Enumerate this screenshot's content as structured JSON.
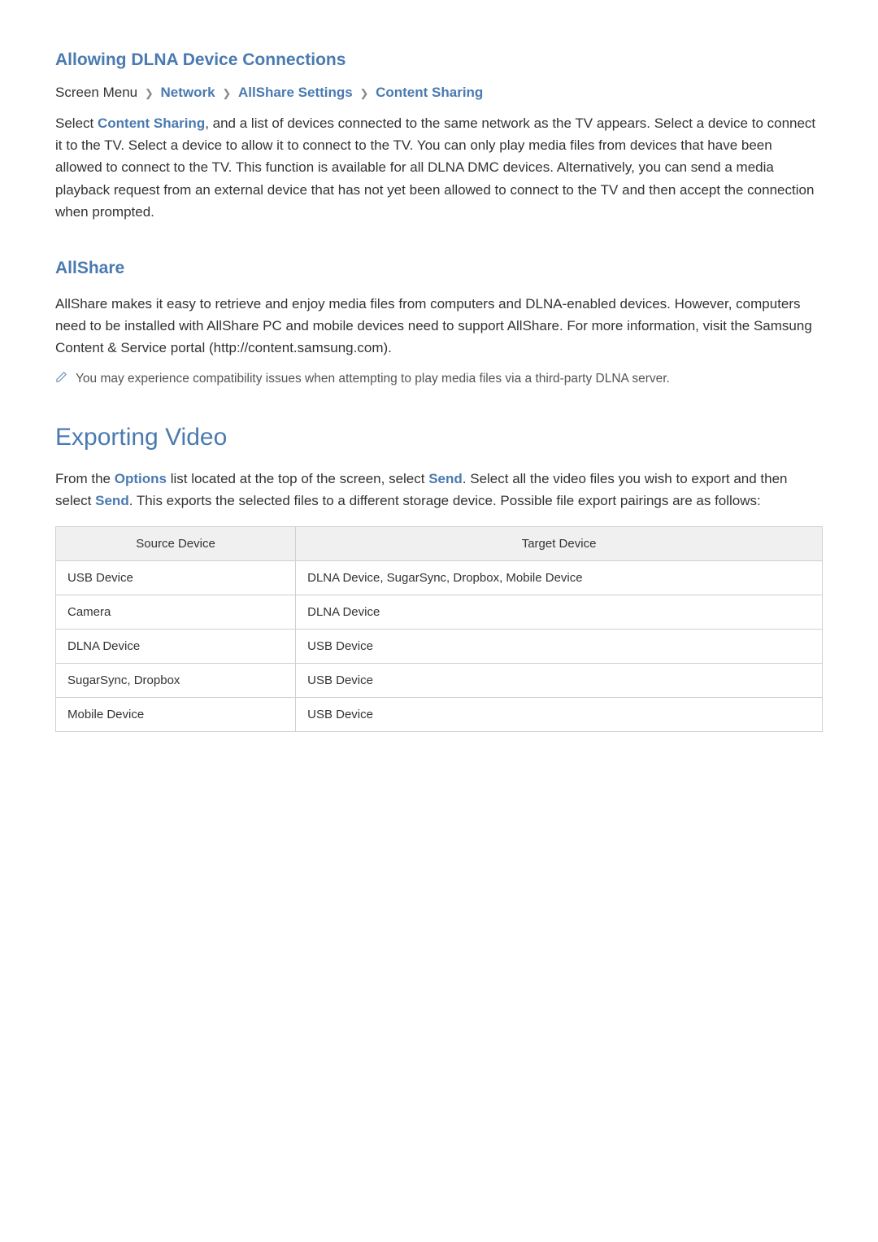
{
  "section1": {
    "heading": "Allowing DLNA Device Connections",
    "breadcrumb": {
      "prefix": "Screen Menu",
      "items": [
        "Network",
        "AllShare Settings",
        "Content Sharing"
      ]
    },
    "para_before": "Select ",
    "para_link": "Content Sharing",
    "para_after": ", and a list of devices connected to the same network as the TV appears. Select a device to connect it to the TV. Select a device to allow it to connect to the TV. You can only play media files from devices that have been allowed to connect to the TV. This function is available for all DLNA DMC devices. Alternatively, you can send a media playback request from an external device that has not yet been allowed to connect to the TV and then accept the connection when prompted."
  },
  "section2": {
    "heading": "AllShare",
    "para": "AllShare makes it easy to retrieve and enjoy media files from computers and DLNA-enabled devices. However, computers need to be installed with AllShare PC and mobile devices need to support AllShare. For more information, visit the Samsung Content & Service portal (http://content.samsung.com).",
    "note": "You may experience compatibility issues when attempting to play media files via a third-party DLNA server."
  },
  "section3": {
    "heading": "Exporting Video",
    "para_a": "From the ",
    "para_link1": "Options",
    "para_b": " list located at the top of the screen, select ",
    "para_link2": "Send",
    "para_c": ". Select all the video files you wish to export and then select ",
    "para_link3": "Send",
    "para_d": ". This exports the selected files to a different storage device. Possible file export pairings are as follows:",
    "table": {
      "headers": [
        "Source Device",
        "Target Device"
      ],
      "rows": [
        [
          "USB Device",
          "DLNA Device, SugarSync, Dropbox, Mobile Device"
        ],
        [
          "Camera",
          "DLNA Device"
        ],
        [
          "DLNA Device",
          "USB Device"
        ],
        [
          "SugarSync, Dropbox",
          "USB Device"
        ],
        [
          "Mobile Device",
          "USB Device"
        ]
      ]
    }
  }
}
